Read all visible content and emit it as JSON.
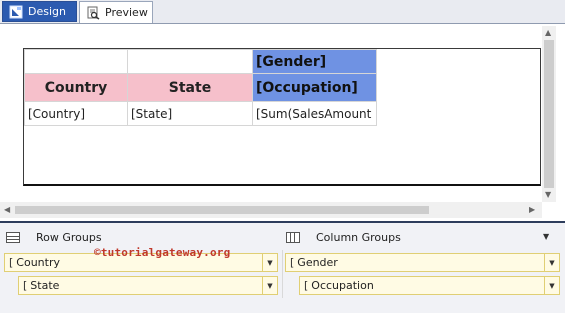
{
  "tabs": [
    {
      "label": "Design",
      "active": true,
      "icon": "design-icon"
    },
    {
      "label": "Preview",
      "active": false,
      "icon": "preview-icon"
    }
  ],
  "matrix": {
    "column_group_header": "[Gender]",
    "row_header_country": "Country",
    "row_header_state": "State",
    "column_subgroup_header": "[Occupation]",
    "data_country": "[Country]",
    "data_state": "[State]",
    "data_value": "[Sum(SalesAmount"
  },
  "grouping": {
    "row_groups_label": "Row Groups",
    "column_groups_label": "Column Groups",
    "row_groups": [
      {
        "label": "Country"
      },
      {
        "label": "State"
      }
    ],
    "column_groups": [
      {
        "label": "Gender"
      },
      {
        "label": "Occupation"
      }
    ]
  },
  "watermark": "©tutorialgateway.org",
  "colors": {
    "header_pink": "#f6c0cb",
    "header_blue": "#6f92e3",
    "tab_active": "#2c5bb0",
    "group_item_bg": "#fffbe4"
  }
}
